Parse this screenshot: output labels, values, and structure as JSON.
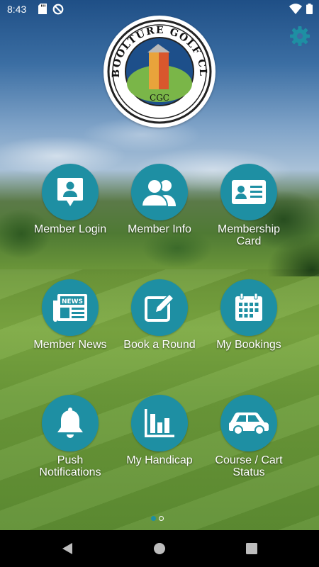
{
  "status_bar": {
    "time": "8:43"
  },
  "logo": {
    "ring_text": "CABOOLTURE GOLF CLUB",
    "initials": "CGC"
  },
  "tiles": [
    {
      "label": "Member Login",
      "icon": "member-login-icon"
    },
    {
      "label": "Member Info",
      "icon": "member-info-icon"
    },
    {
      "label": "Membership\nCard",
      "icon": "membership-card-icon"
    },
    {
      "label": "Member News",
      "icon": "news-icon"
    },
    {
      "label": "Book a Round",
      "icon": "edit-icon"
    },
    {
      "label": "My Bookings",
      "icon": "calendar-icon"
    },
    {
      "label": "Push\nNotifications",
      "icon": "bell-icon"
    },
    {
      "label": "My Handicap",
      "icon": "bar-chart-icon"
    },
    {
      "label": "Course / Cart\nStatus",
      "icon": "car-icon"
    }
  ],
  "news_icon_text": "NEWS",
  "pager": {
    "pages": 2,
    "active": 1
  },
  "colors": {
    "accent": "#1e8fa3",
    "gear": "#1e8fa3"
  }
}
